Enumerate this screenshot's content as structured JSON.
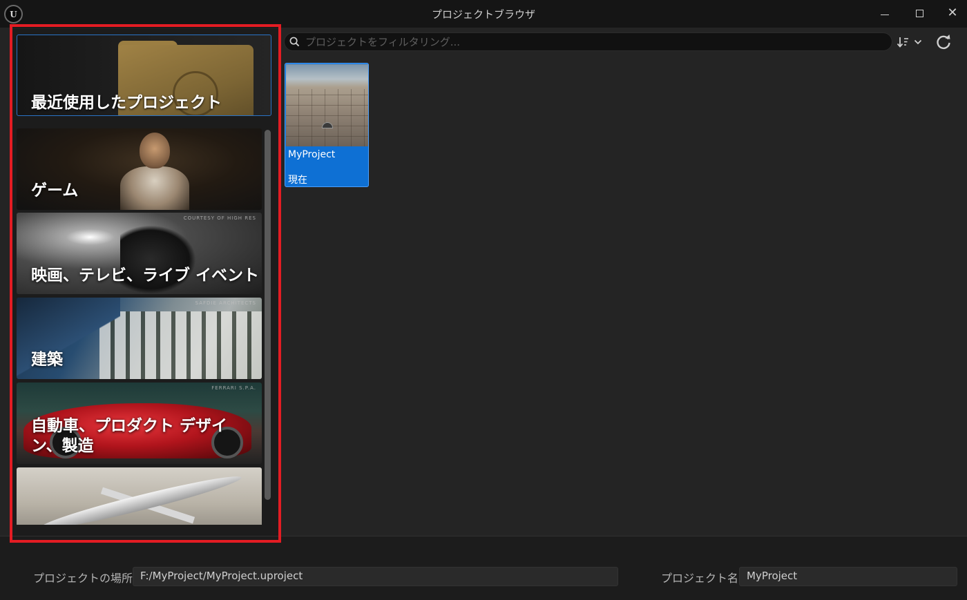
{
  "window": {
    "title": "プロジェクトブラウザ",
    "logo_text": "U",
    "minimize_icon": "minimize-icon",
    "maximize_icon": "maximize-icon",
    "close_glyph": "✕"
  },
  "sidebar": {
    "recent": {
      "label": "最近使用したプロジェクト",
      "icon": "folder-icon"
    },
    "categories": [
      {
        "label": "ゲーム",
        "credit": ""
      },
      {
        "label": "映画、テレビ、ライブ イベント",
        "credit": "COURTESY OF HIGH RES"
      },
      {
        "label": "建築",
        "credit": "SAFDIE ARCHITECTS"
      },
      {
        "label": "自動車、プロダクト デザイン、製造",
        "credit": "FERRARI S.P.A."
      },
      {
        "label": "",
        "credit": ""
      }
    ]
  },
  "search": {
    "placeholder": "プロジェクトをフィルタリング...",
    "value": "",
    "icon": "search-icon"
  },
  "toolbar": {
    "sort_icon": "sort-icon",
    "refresh_icon": "refresh-icon"
  },
  "projects": [
    {
      "name": "MyProject",
      "version": "現在",
      "selected": true
    }
  ],
  "footer": {
    "location_label": "プロジェクトの場所",
    "location_value": "F:/MyProject/MyProject.uproject",
    "name_label": "プロジェクト名",
    "name_value": "MyProject"
  },
  "colors": {
    "accent": "#0e70d4",
    "highlight": "#e31c23",
    "background": "#242424"
  }
}
